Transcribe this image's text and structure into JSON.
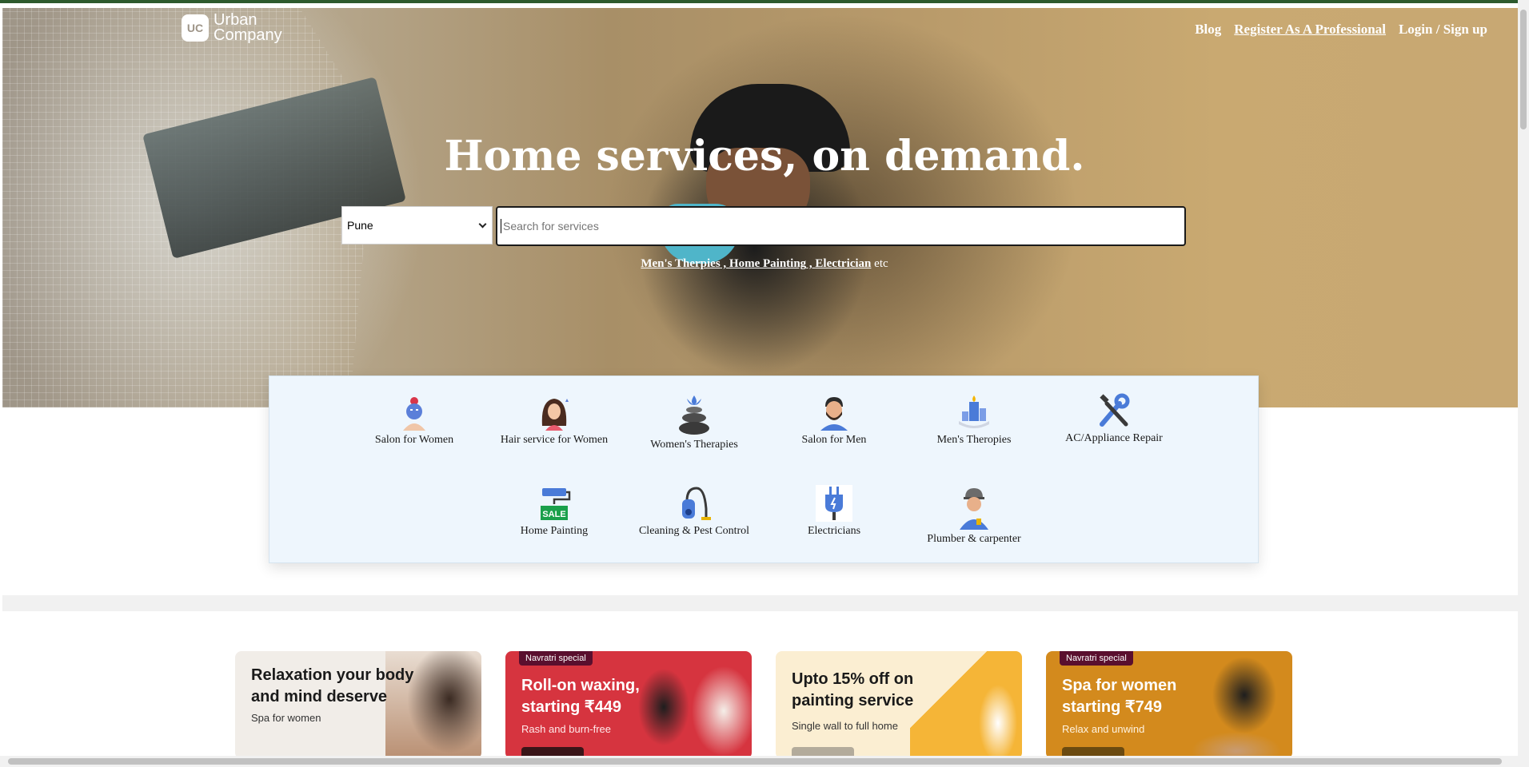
{
  "brand": {
    "badge": "UC",
    "line1": "Urban",
    "line2": "Company"
  },
  "nav": {
    "blog": "Blog",
    "register": "Register As A Professional",
    "login": "Login / Sign up"
  },
  "hero": {
    "title": "Home services, on demand.",
    "city": "Pune",
    "search_placeholder": "Search for services",
    "suggestions": [
      "Men's Therpies",
      "Home Painting",
      "Electrician"
    ],
    "suggest_sep": " , ",
    "suggest_tail": " etc"
  },
  "categories": [
    {
      "label": "Salon for Women",
      "icon": "woman-facial-icon"
    },
    {
      "label": "Hair service for Women",
      "icon": "woman-hair-icon"
    },
    {
      "label": "Women's Therapies",
      "icon": "spa-stones-icon"
    },
    {
      "label": "Salon for Men",
      "icon": "man-beard-icon"
    },
    {
      "label": "Men's Theropies",
      "icon": "candle-spa-icon"
    },
    {
      "label": "AC/Appliance Repair",
      "icon": "wrench-screwdriver-icon"
    },
    {
      "label": "Home Painting",
      "icon": "paint-roller-icon"
    },
    {
      "label": "Cleaning & Pest Control",
      "icon": "vacuum-cleaner-icon"
    },
    {
      "label": "Electricians",
      "icon": "plug-icon"
    },
    {
      "label": "Plumber & carpenter",
      "icon": "worker-helmet-icon"
    }
  ],
  "promos": [
    {
      "tag": "",
      "title": "Relaxation your body and mind deserve",
      "subtitle": "Spa for women",
      "bg": "#f1ede8",
      "color": "#1a1a1a"
    },
    {
      "tag": "Navratri special",
      "title": "Roll-on waxing, starting ₹449",
      "subtitle": "Rash and burn-free",
      "bg": "#d6343f",
      "color": "#ffffff"
    },
    {
      "tag": "",
      "title": "Upto 15% off on painting service",
      "subtitle": "Single wall to full home",
      "bg": "#fbeed2",
      "color": "#1a1a1a"
    },
    {
      "tag": "Navratri special",
      "title": "Spa for women starting ₹749",
      "subtitle": "Relax and unwind",
      "bg": "#d38a1d",
      "color": "#ffffff"
    }
  ],
  "icons": {
    "select_chevron": "chevron-down-icon"
  }
}
